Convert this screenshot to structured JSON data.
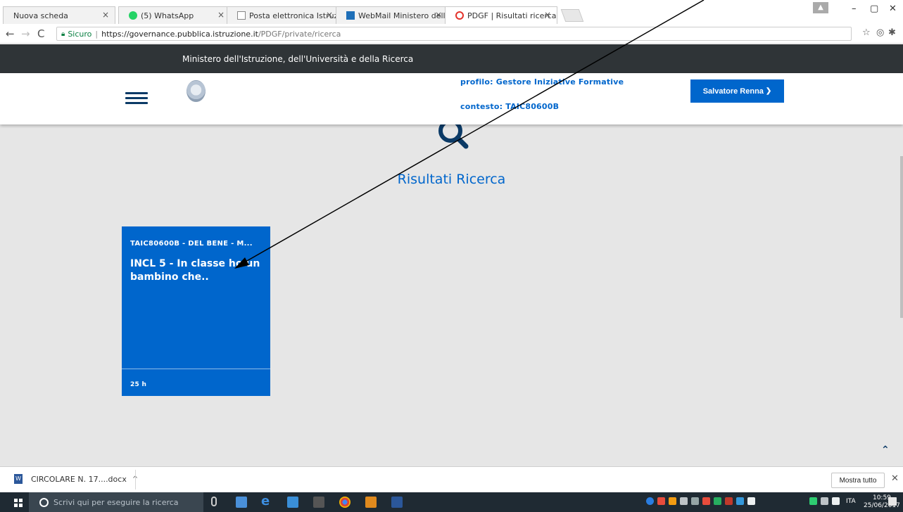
{
  "browser": {
    "tabs": [
      {
        "label": "Nuova scheda",
        "favicon_color": "#ffffff",
        "active": false
      },
      {
        "label": "(5) WhatsApp",
        "favicon_color": "#25d366",
        "active": false
      },
      {
        "label": "Posta elettronica Istruzio",
        "favicon_color": "#ffffff",
        "active": false
      },
      {
        "label": "WebMail Ministero dell'I",
        "favicon_color": "#1e6fb8",
        "active": false
      },
      {
        "label": "PDGF | Risultati ricerca",
        "favicon_color": "#e3322b",
        "active": true
      }
    ],
    "tab_close": "×",
    "address": {
      "secure_label": "Sicuro",
      "host": "https://governance.pubblica.istruzione.it",
      "path": "/PDGF/private/ricerca"
    }
  },
  "site": {
    "ministry_name": "Ministero dell'Istruzione, dell'Università e della Ricerca",
    "profile": "profilo: Gestore Iniziative Formative",
    "context": "contesto: TAIC80600B",
    "user_name": "Salvatore Renna",
    "results_title": "Risultati Ricerca",
    "result_card": {
      "code": "TAIC80600B - DEL BENE - M...",
      "title": "INCL 5 - In classe ho un bambino che..",
      "hours": "25 h"
    },
    "accent_color": "#0066cc"
  },
  "download_bar": {
    "file_name": "CIRCOLARE N. 17....docx",
    "show_all": "Mostra tutto"
  },
  "taskbar": {
    "search_placeholder": "Scrivi qui per eseguire la ricerca",
    "language": "ITA",
    "time": "10:59",
    "date": "25/06/2017"
  }
}
